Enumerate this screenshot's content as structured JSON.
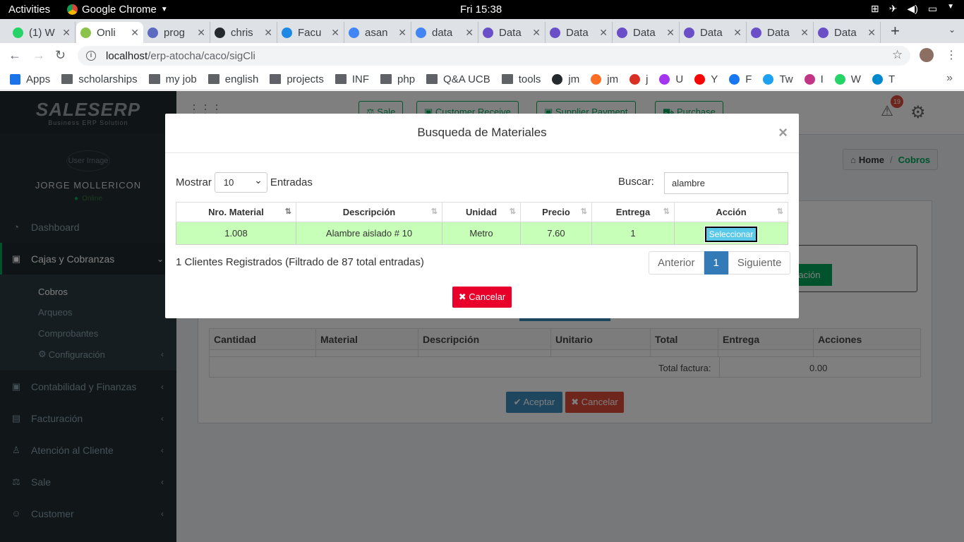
{
  "gnome": {
    "activities": "Activities",
    "app": "Google Chrome",
    "clock": "Fri 15:38"
  },
  "tabs": [
    {
      "title": "(1) W",
      "color": "#25d366"
    },
    {
      "title": "Onli",
      "color": "#8bc34a"
    },
    {
      "title": "prog",
      "color": "#5c6bc0"
    },
    {
      "title": "chris",
      "color": "#24292e"
    },
    {
      "title": "Facu",
      "color": "#1e88e5"
    },
    {
      "title": "asan",
      "color": "#4285f4"
    },
    {
      "title": "data",
      "color": "#4285f4"
    },
    {
      "title": "Data",
      "color": "#6a4fc9"
    },
    {
      "title": "Data",
      "color": "#6a4fc9"
    },
    {
      "title": "Data",
      "color": "#6a4fc9"
    },
    {
      "title": "Data",
      "color": "#6a4fc9"
    },
    {
      "title": "Data",
      "color": "#6a4fc9"
    },
    {
      "title": "Data",
      "color": "#6a4fc9"
    }
  ],
  "address": {
    "host": "localhost",
    "path": "/erp-atocha/caco/sigCli"
  },
  "bookmarks": [
    {
      "label": "Apps",
      "icon": "apps-icon"
    },
    {
      "label": "scholarships",
      "icon": "folder-icon"
    },
    {
      "label": "my job",
      "icon": "folder-icon"
    },
    {
      "label": "english",
      "icon": "folder-icon"
    },
    {
      "label": "projects",
      "icon": "folder-icon"
    },
    {
      "label": "INF",
      "icon": "folder-icon"
    },
    {
      "label": "php",
      "icon": "folder-icon"
    },
    {
      "label": "Q&A UCB",
      "icon": "folder-icon"
    },
    {
      "label": "tools",
      "icon": "folder-icon"
    },
    {
      "label": "jm",
      "icon": "github-icon"
    },
    {
      "label": "jm",
      "icon": "gitlab-icon"
    },
    {
      "label": "j",
      "icon": "gmail-icon"
    },
    {
      "label": "U",
      "icon": "udemy-icon"
    },
    {
      "label": "Y",
      "icon": "youtube-icon"
    },
    {
      "label": "F",
      "icon": "facebook-icon"
    },
    {
      "label": "Tw",
      "icon": "twitter-icon"
    },
    {
      "label": "I",
      "icon": "instagram-icon"
    },
    {
      "label": "W",
      "icon": "whatsapp-icon"
    },
    {
      "label": "T",
      "icon": "telegram-icon"
    }
  ],
  "sidebar": {
    "logo": "SALESERP",
    "logo_sub": "Business ERP Solution",
    "user_img_alt": "User Image",
    "user_name": "JORGE MOLLERICON",
    "status": "Online",
    "items": [
      {
        "label": "Dashboard"
      },
      {
        "label": "Cajas y Cobranzas"
      },
      {
        "label": "Contabilidad y Finanzas"
      },
      {
        "label": "Facturación"
      },
      {
        "label": "Atención al Cliente"
      },
      {
        "label": "Sale"
      },
      {
        "label": "Customer"
      }
    ],
    "sub": [
      "Cobros",
      "Arqueos",
      "Comprobantes",
      "Configuración"
    ]
  },
  "header": {
    "buttons": [
      "Sale",
      "Customer Receive",
      "Supplier Payment",
      "Purchase"
    ],
    "badge": "19"
  },
  "breadcrumb": {
    "home": "Home",
    "current": "Cobros"
  },
  "background": {
    "action_button": "ización",
    "columns": [
      "Cantidad",
      "Material",
      "Descripción",
      "Unitario",
      "Total",
      "Entrega",
      "Acciones"
    ],
    "total_label": "Total factura:",
    "total_value": "0.00",
    "accept": "Aceptar",
    "cancel": "Cancelar"
  },
  "modal": {
    "title": "Busqueda de Materiales",
    "show_label": "Mostrar",
    "show_value": "10",
    "entries_label": "Entradas",
    "search_label": "Buscar:",
    "search_value": "alambre",
    "columns": [
      "Nro. Material",
      "Descripción",
      "Unidad",
      "Precio",
      "Entrega",
      "Acción"
    ],
    "rows": [
      {
        "nro": "1.008",
        "desc": "Alambre aislado # 10",
        "unidad": "Metro",
        "precio": "7.60",
        "entrega": "1",
        "accion": "Seleccionar"
      }
    ],
    "info": "1 Clientes Registrados (Filtrado de 87 total entradas)",
    "pager": {
      "prev": "Anterior",
      "page": "1",
      "next": "Siguiente"
    },
    "cancel": "Cancelar"
  }
}
